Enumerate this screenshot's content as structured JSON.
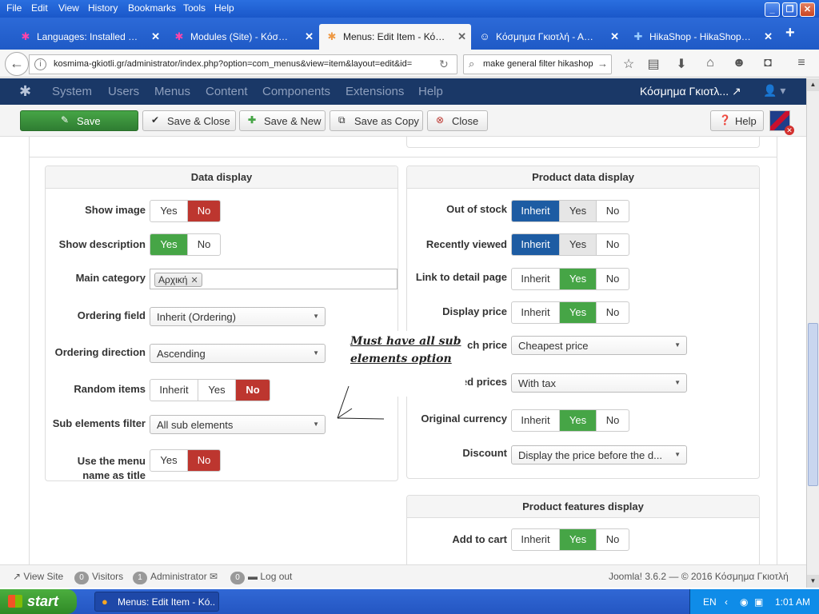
{
  "browser": {
    "menu": [
      "File",
      "Edit",
      "View",
      "History",
      "Bookmarks",
      "Tools",
      "Help"
    ],
    "tabs": [
      {
        "label": "Languages: Installed (Ad...",
        "icon": "joomla-icon"
      },
      {
        "label": "Modules (Site) - Κόσμημα ...",
        "icon": "joomla-icon"
      },
      {
        "label": "Menus: Edit Item - Κόσμη...",
        "icon": "joomla-icon"
      },
      {
        "label": "Κόσμημα Γκιοτλή - Αρχική",
        "icon": "site-icon"
      },
      {
        "label": "HikaShop - HikaShop - To...",
        "icon": "hikashop-icon"
      }
    ],
    "url": "kosmima-gkiotli.gr/administrator/index.php?option=com_menus&view=item&layout=edit&id=",
    "search_value": "make general filter hikashop",
    "new_tab": "+"
  },
  "joomla_nav": {
    "items": [
      "System",
      "Users",
      "Menus",
      "Content",
      "Components",
      "Extensions",
      "Help"
    ],
    "site_name": "Κόσμημα Γκιοτλ..."
  },
  "toolbar": {
    "save": "Save",
    "save_close": "Save & Close",
    "save_new": "Save & New",
    "save_copy": "Save as Copy",
    "close": "Close",
    "help": "Help"
  },
  "data_display": {
    "title": "Data display",
    "show_image": {
      "label": "Show image",
      "options": [
        "Yes",
        "No"
      ],
      "selected": "No"
    },
    "show_description": {
      "label": "Show description",
      "options": [
        "Yes",
        "No"
      ],
      "selected": "Yes"
    },
    "main_category": {
      "label": "Main category",
      "chip": "Αρχική"
    },
    "ordering_field": {
      "label": "Ordering field",
      "value": "Inherit (Ordering)"
    },
    "ordering_direction": {
      "label": "Ordering direction",
      "value": "Ascending"
    },
    "random_items": {
      "label": "Random items",
      "options": [
        "Inherit",
        "Yes",
        "No"
      ],
      "selected": "No"
    },
    "sub_elements_filter": {
      "label": "Sub elements filter",
      "value": "All sub elements"
    },
    "use_menu_name": {
      "label_line1": "Use the menu",
      "label_line2": "name as title",
      "options": [
        "Yes",
        "No"
      ],
      "selected": "No"
    }
  },
  "annotation": {
    "line1": "Must have all sub",
    "line2": "elements option"
  },
  "product_data_display": {
    "title": "Product data display",
    "out_of_stock": {
      "label": "Out of stock",
      "options": [
        "Inherit",
        "Yes",
        "No"
      ],
      "selected": "Inherit"
    },
    "recently_viewed": {
      "label": "Recently viewed",
      "options": [
        "Inherit",
        "Yes",
        "No"
      ],
      "selected": "Inherit"
    },
    "link_detail": {
      "label": "Link to detail page",
      "options": [
        "Inherit",
        "Yes",
        "No"
      ],
      "selected": "Yes"
    },
    "display_price": {
      "label": "Display price",
      "options": [
        "Inherit",
        "Yes",
        "No"
      ],
      "selected": "Yes"
    },
    "price_label_partial": "ch price",
    "price_value": "Cheapest price",
    "taxed_label_partial": "ed prices",
    "taxed_value": "With tax",
    "original_currency": {
      "label": "Original currency",
      "options": [
        "Inherit",
        "Yes",
        "No"
      ],
      "selected": "Yes"
    },
    "discount": {
      "label": "Discount",
      "value": "Display the price before the d..."
    }
  },
  "product_features": {
    "title": "Product features display",
    "add_to_cart": {
      "label": "Add to cart",
      "options": [
        "Inherit",
        "Yes",
        "No"
      ],
      "selected": "Yes"
    }
  },
  "status_bar": {
    "view_site": "View Site",
    "visitors_count": "0",
    "visitors": "Visitors",
    "admin_count": "1",
    "admin": "Administrator",
    "msg_count": "0",
    "logout": "Log out",
    "copyright": "Joomla! 3.6.2 — © 2016 Κόσμημα Γκιοτλή"
  },
  "taskbar": {
    "start": "start",
    "task": "Menus: Edit Item - Kó...",
    "lang": "EN",
    "time": "1:01 AM"
  },
  "colors": {
    "brand_nav": "#1a3867",
    "green": "#46a546",
    "red": "#bd362f",
    "blue": "#1d5ca3"
  }
}
